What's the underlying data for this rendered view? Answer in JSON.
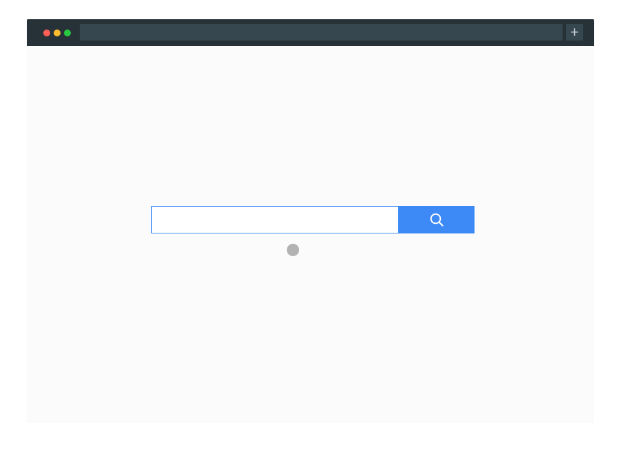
{
  "window": {
    "traffic_lights": [
      "close",
      "minimize",
      "zoom"
    ],
    "address_bar": {
      "value": ""
    },
    "new_tab_label": "+"
  },
  "search": {
    "value": "",
    "placeholder": "",
    "button_icon": "search-icon"
  },
  "colors": {
    "titlebar": "#263238",
    "address_bar": "#37474f",
    "accent": "#3d8af7",
    "page_background": "#fbfbfb",
    "pointer": "#b3b3b3"
  }
}
